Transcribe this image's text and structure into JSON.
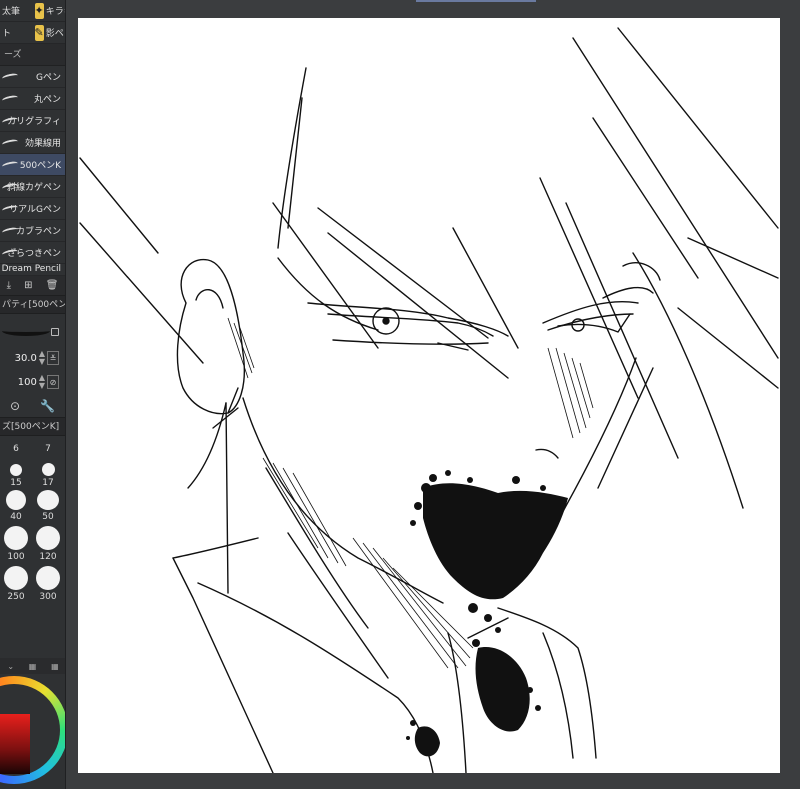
{
  "subtools": {
    "row1": [
      "太筆",
      "キラキ"
    ],
    "row2": [
      "ト",
      "影ペン"
    ],
    "group_tab": "ーズ"
  },
  "brushes": [
    {
      "label": "Gペン",
      "selected": false
    },
    {
      "label": "丸ペン",
      "selected": false
    },
    {
      "label": "カリグラフィ",
      "selected": false
    },
    {
      "label": "効果線用",
      "selected": false
    },
    {
      "label": "500ペンK",
      "selected": true
    },
    {
      "label": "斜線カゲペン",
      "selected": false
    },
    {
      "label": "リアルGペン",
      "selected": false
    },
    {
      "label": "カブラペン",
      "selected": false
    },
    {
      "label": "ざらつきペン",
      "selected": false
    },
    {
      "label": "Dream Pencil",
      "selected": false
    }
  ],
  "tool_property": {
    "title": "パティ[500ペン",
    "brush_size": "30.0",
    "opacity": "100"
  },
  "brush_size_panel": {
    "title": "ズ[500ペンK]",
    "sizes": [
      "6",
      "7",
      "15",
      "17",
      "40",
      "50",
      "100",
      "120",
      "250",
      "300"
    ]
  },
  "colors": {
    "main_color": "#e8201c",
    "panel_bg": "#2f3133",
    "selected_bg": "#3e4a63"
  }
}
